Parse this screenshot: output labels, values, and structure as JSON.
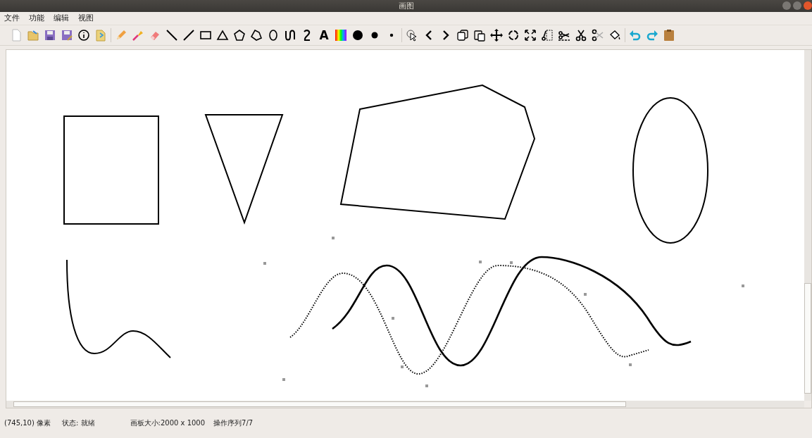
{
  "window": {
    "title": "画图"
  },
  "menu": [
    "文件",
    "功能",
    "编辑",
    "视图"
  ],
  "toolbar": [
    {
      "kind": "new"
    },
    {
      "kind": "open"
    },
    {
      "kind": "save"
    },
    {
      "kind": "save-as"
    },
    {
      "kind": "info"
    },
    {
      "kind": "import"
    },
    {
      "kind": "separator"
    },
    {
      "kind": "pencil"
    },
    {
      "kind": "brush"
    },
    {
      "kind": "eraser"
    },
    {
      "kind": "line-down"
    },
    {
      "kind": "line-up"
    },
    {
      "kind": "rectangle"
    },
    {
      "kind": "triangle"
    },
    {
      "kind": "pentagon"
    },
    {
      "kind": "polygon"
    },
    {
      "kind": "ellipse"
    },
    {
      "kind": "curve"
    },
    {
      "kind": "s-curve"
    },
    {
      "kind": "text",
      "label": "A"
    },
    {
      "kind": "palette"
    },
    {
      "kind": "dot-large"
    },
    {
      "kind": "dot-medium"
    },
    {
      "kind": "dot-small"
    },
    {
      "kind": "separator"
    },
    {
      "kind": "pointer"
    },
    {
      "kind": "prev"
    },
    {
      "kind": "next"
    },
    {
      "kind": "copy"
    },
    {
      "kind": "paste"
    },
    {
      "kind": "move"
    },
    {
      "kind": "rotate"
    },
    {
      "kind": "scale"
    },
    {
      "kind": "crop"
    },
    {
      "kind": "cut-line"
    },
    {
      "kind": "scissors"
    },
    {
      "kind": "scissors-open"
    },
    {
      "kind": "fill"
    },
    {
      "kind": "separator"
    },
    {
      "kind": "undo"
    },
    {
      "kind": "redo"
    },
    {
      "kind": "clipboard"
    }
  ],
  "status_bar": [
    "(745,10) 像素",
    "状态: 就绪",
    "画板大小:2000 x 1000",
    "操作序列7/7"
  ]
}
